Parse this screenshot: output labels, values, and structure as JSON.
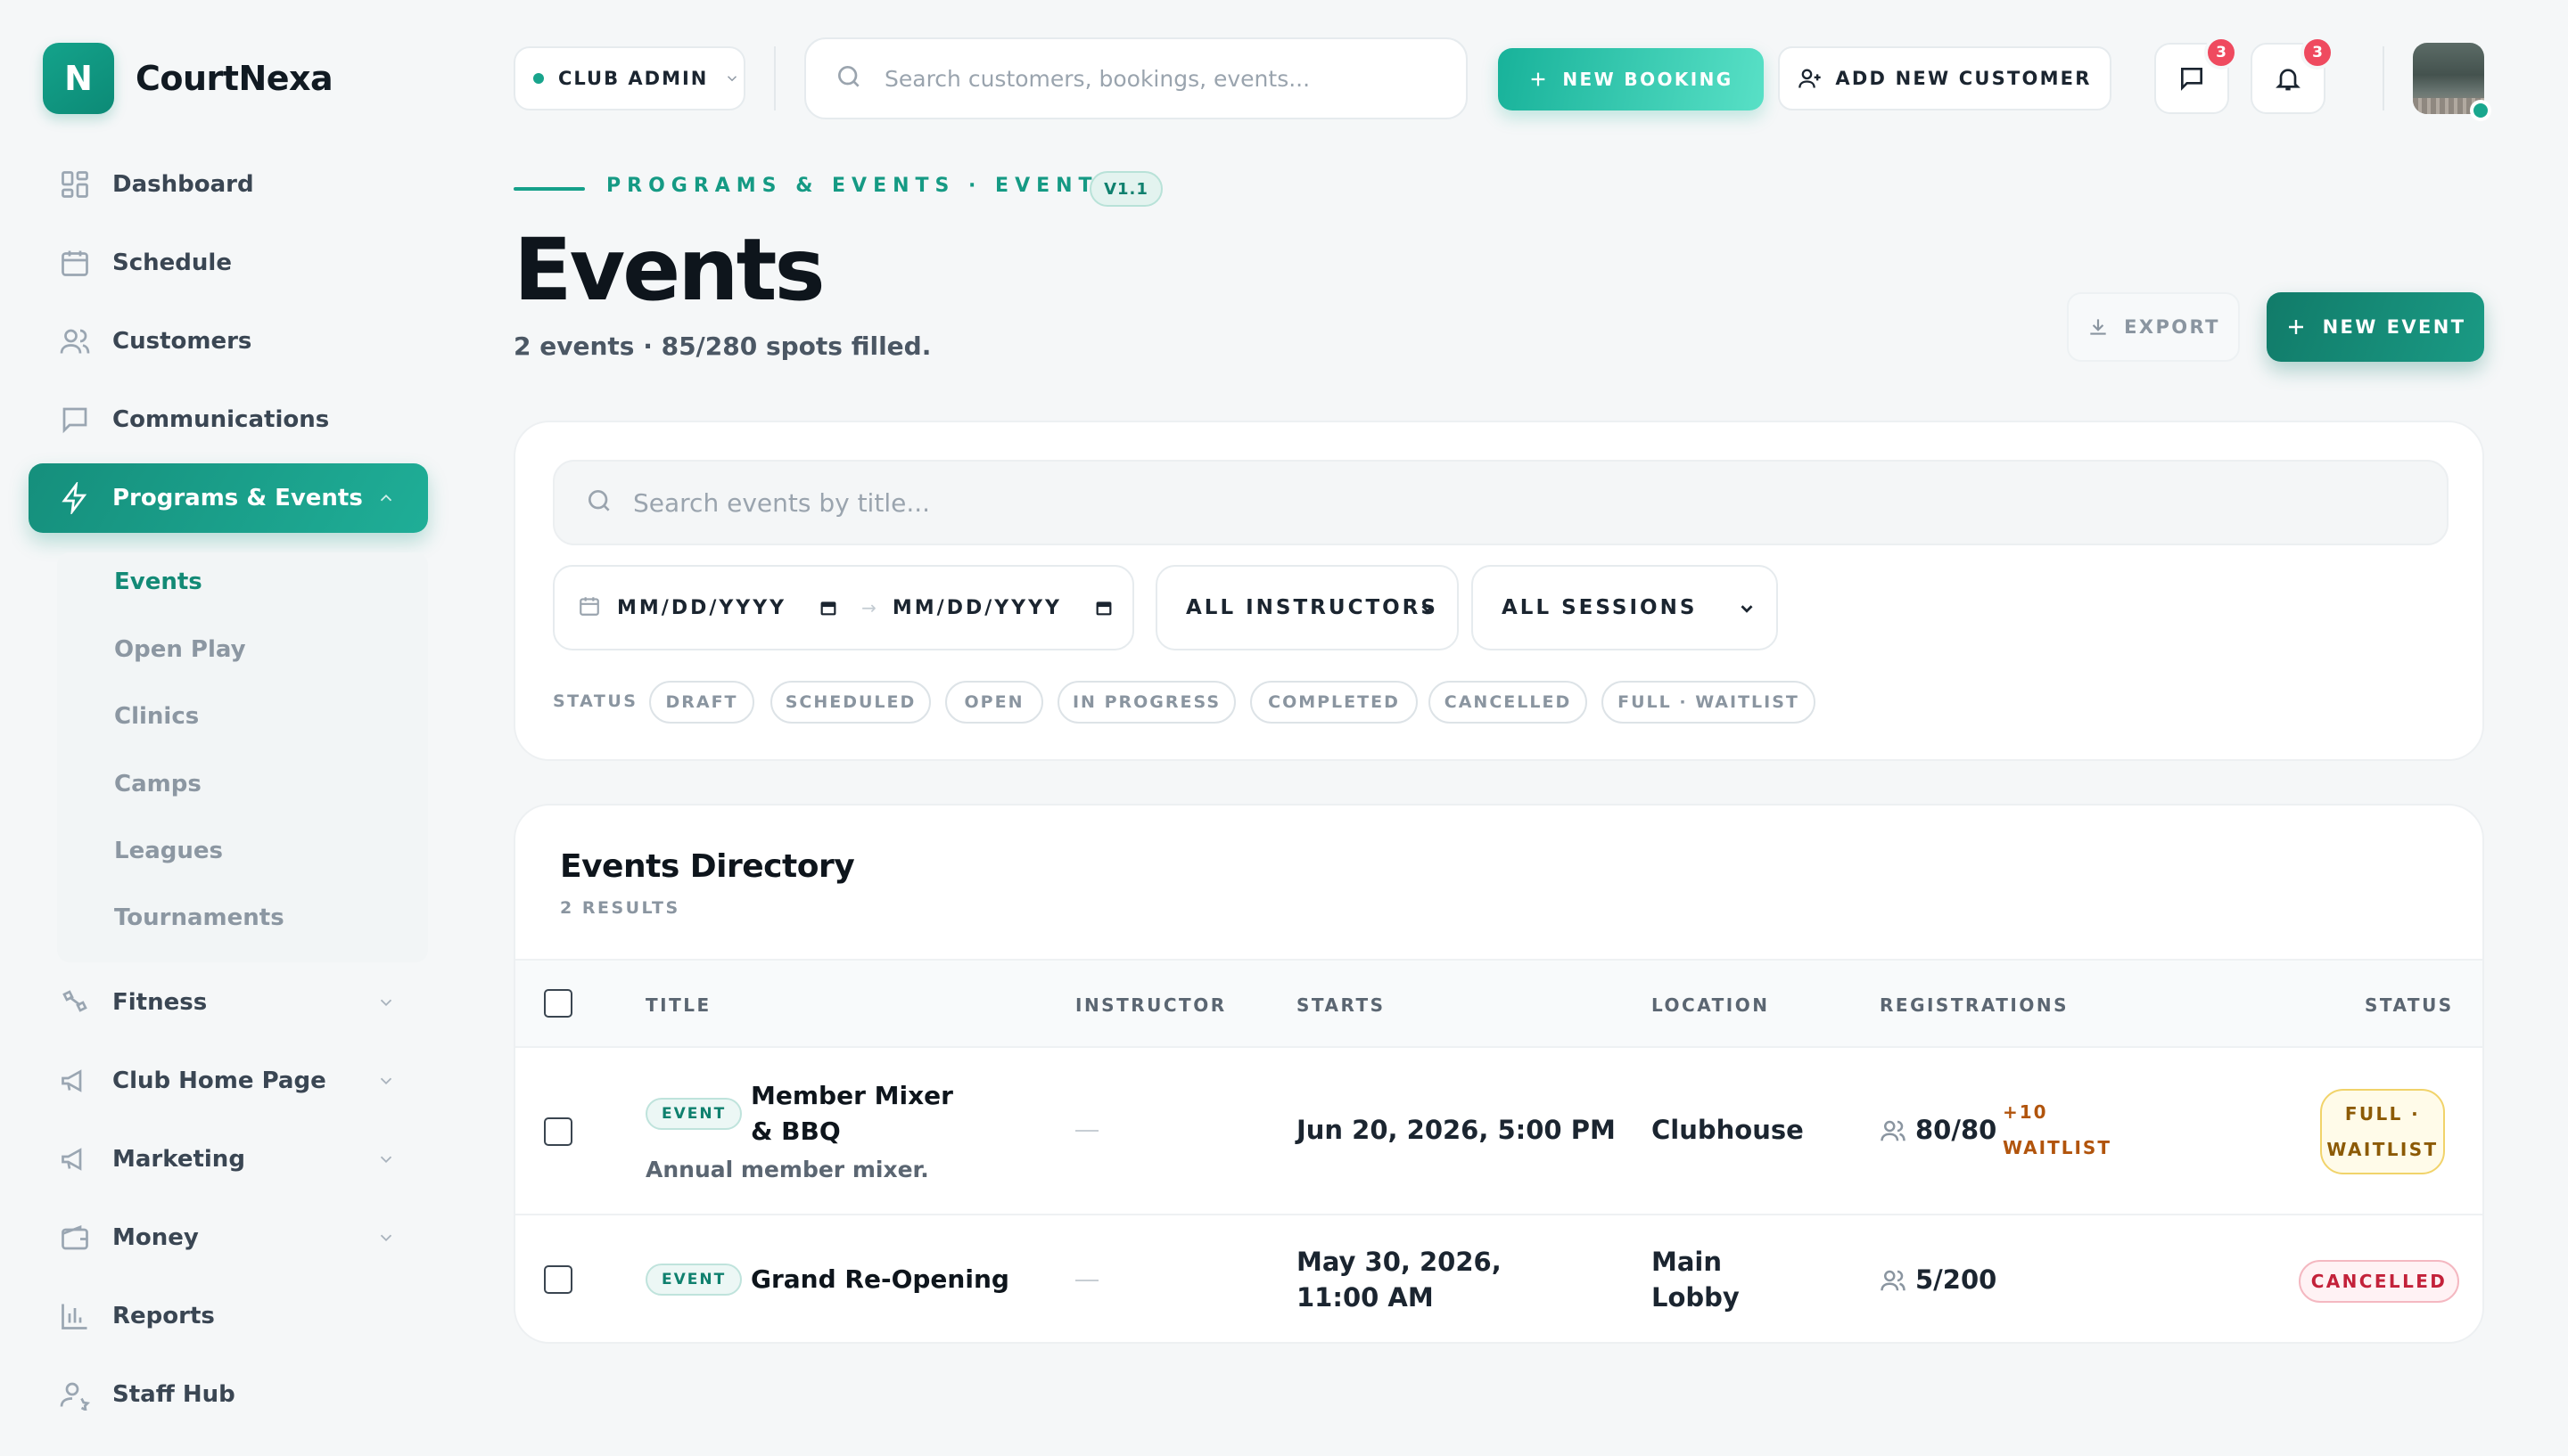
{
  "brand": {
    "logo_letter": "N",
    "name": "CourtNexa"
  },
  "sidebar": {
    "items": [
      {
        "label": "Dashboard",
        "icon": "dashboard-icon"
      },
      {
        "label": "Schedule",
        "icon": "calendar-icon"
      },
      {
        "label": "Customers",
        "icon": "users-icon"
      },
      {
        "label": "Communications",
        "icon": "message-icon"
      },
      {
        "label": "Programs & Events",
        "icon": "lightning-icon",
        "active": true,
        "expanded": true
      },
      {
        "label": "Fitness",
        "icon": "fitness-icon",
        "has_children": true
      },
      {
        "label": "Club Home Page",
        "icon": "megaphone-icon",
        "has_children": true
      },
      {
        "label": "Marketing",
        "icon": "megaphone-icon",
        "has_children": true
      },
      {
        "label": "Money",
        "icon": "wallet-icon",
        "has_children": true
      },
      {
        "label": "Reports",
        "icon": "bar-chart-icon"
      },
      {
        "label": "Staff Hub",
        "icon": "staff-icon"
      }
    ],
    "sub_items": [
      {
        "label": "Events",
        "active": true
      },
      {
        "label": "Open Play"
      },
      {
        "label": "Clinics"
      },
      {
        "label": "Camps"
      },
      {
        "label": "Leagues"
      },
      {
        "label": "Tournaments"
      }
    ]
  },
  "topbar": {
    "role": "CLUB ADMIN",
    "search_placeholder": "Search customers, bookings, events...",
    "new_booking_label": "NEW BOOKING",
    "add_customer_label": "ADD NEW CUSTOMER",
    "messages_count": "3",
    "notifications_count": "3"
  },
  "header": {
    "breadcrumb": "PROGRAMS & EVENTS · EVENTS",
    "version": "V1.1",
    "title": "Events",
    "subtitle": "2 events · 85/280 spots filled.",
    "export_label": "EXPORT",
    "new_event_label": "NEW EVENT"
  },
  "filters": {
    "search_placeholder": "Search events by title...",
    "date_from_placeholder": "MM/DD/YYYY",
    "date_to_placeholder": "MM/DD/YYYY",
    "instructor_select": "ALL INSTRUCTORS",
    "session_select": "ALL SESSIONS",
    "status_label": "STATUS",
    "status_chips": [
      "DRAFT",
      "SCHEDULED",
      "OPEN",
      "IN PROGRESS",
      "COMPLETED",
      "CANCELLED",
      "FULL · WAITLIST"
    ]
  },
  "directory": {
    "title": "Events Directory",
    "count": "2 RESULTS",
    "columns": [
      "TITLE",
      "INSTRUCTOR",
      "STARTS",
      "LOCATION",
      "REGISTRATIONS",
      "STATUS"
    ],
    "rows": [
      {
        "type": "EVENT",
        "title": "Member Mixer & BBQ",
        "description": "Annual member mixer.",
        "instructor": "—",
        "starts": "Jun 20, 2026, 5:00 PM",
        "location": "Clubhouse",
        "registrations": "80/80",
        "waitlist": "+10 WAITLIST",
        "status": "FULL · WAITLIST"
      },
      {
        "type": "EVENT",
        "title": "Grand Re-Opening",
        "description": "",
        "instructor": "—",
        "starts": "May 30, 2026, 11:00 AM",
        "location": "Main Lobby",
        "registrations": "5/200",
        "waitlist": "",
        "status": "CANCELLED"
      }
    ]
  },
  "colors": {
    "accent": "#15a08a",
    "accent_dark": "#117b69",
    "badge_red": "#ef4a5f",
    "waitlist_text": "#b1540c",
    "cancelled_text": "#c3223a"
  }
}
